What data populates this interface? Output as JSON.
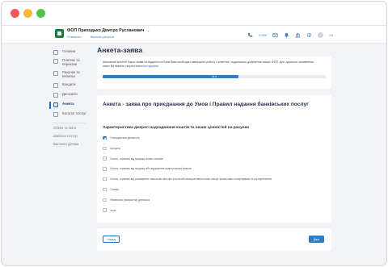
{
  "header": {
    "company": "ФОП Приходько Дмитро Русланович",
    "company_caret": "⌄",
    "links": [
      "Реквізити",
      "Мульти-рахунок"
    ],
    "phone": "0 800",
    "lang": "УА"
  },
  "sidebar": {
    "items": [
      {
        "label": "Головна",
        "icon": "home-icon"
      },
      {
        "label": "Платежі та перекази",
        "icon": "transfer-icon"
      },
      {
        "label": "Рахунки та виписки",
        "icon": "accounts-icon"
      },
      {
        "label": "Кредити",
        "icon": "credit-icon"
      },
      {
        "label": "Депозити",
        "icon": "deposit-icon"
      },
      {
        "label": "Анкета",
        "icon": "form-icon"
      },
      {
        "label": "Каталог послуг",
        "icon": "catalog-icon"
      }
    ],
    "secondary": [
      "Обмін та звіти",
      "Шаблон послуг",
      "Виплати діячам"
    ]
  },
  "page": {
    "title": "Анкета-заява"
  },
  "notice": {
    "text": "Шановний клієнте! Ваша заява на відкриття в Банкі Вам необхідно завершити роботу з анкетою і подальшою документів наших ФОП. Для зручності заповнення анкет Ви можете скористатися",
    "link": "інструкцією",
    "progress_label": "61%",
    "progress_fraction": 0.61
  },
  "form": {
    "heading": "Анкета - заява про приєднання до Умов і Правил надання банківських послуг",
    "subheading": "Характеристика джерел надходження коштів та інших цінностей на рахунки",
    "options": [
      {
        "label": "Господарська діяльність",
        "checked": true
      },
      {
        "label": "Кредити",
        "checked": false
      },
      {
        "label": "Кошти, отримані від продажу цінних паперів",
        "checked": false
      },
      {
        "label": "Кошти, отримані від продажу або відчуження прав грошової вимоги",
        "checked": false
      },
      {
        "label": "Кошти, отримані від розміщення тимчасово вільних коштів або використання інших послуг фінансових посередників та корпоративних",
        "checked": false
      },
      {
        "label": "Позика",
        "checked": false
      },
      {
        "label": "Фінансова (поворотна) допомога",
        "checked": false
      },
      {
        "label": "Інше",
        "checked": false
      }
    ]
  },
  "footer": {
    "back_label": "Назад",
    "next_label": "Далі"
  },
  "colors": {
    "accent": "#2a7fc8",
    "brand": "#1e7a3c"
  }
}
